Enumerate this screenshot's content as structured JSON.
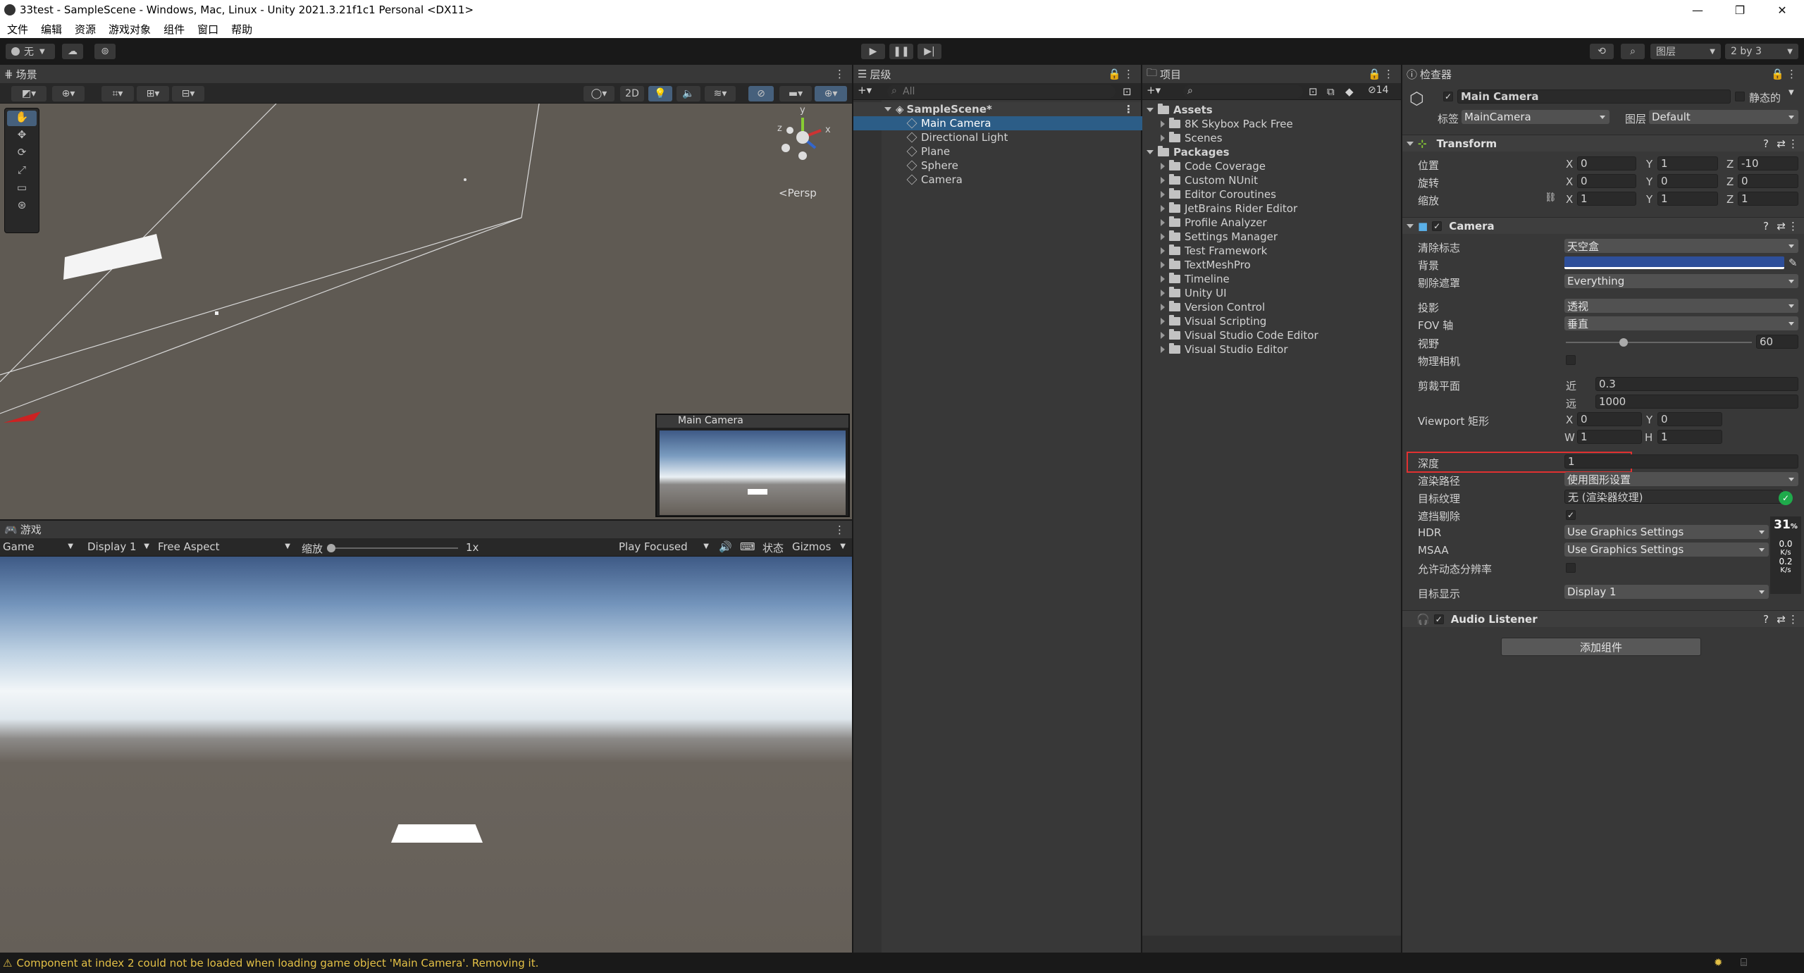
{
  "window": {
    "title": "33test - SampleScene - Windows, Mac, Linux - Unity 2021.3.21f1c1 Personal <DX11>",
    "minimize": "—",
    "maximize": "❐",
    "close": "✕"
  },
  "menu": [
    "文件",
    "编辑",
    "资源",
    "游戏对象",
    "组件",
    "窗口",
    "帮助"
  ],
  "toolbar": {
    "account": "无",
    "layers_label": "图层",
    "layout_label": "2 by 3"
  },
  "scene": {
    "tab": "场景",
    "toggle_2d": "2D",
    "persp_label": "<Persp",
    "gizmo_y": "y",
    "gizmo_x": "x",
    "gizmo_z": "z",
    "camera_preview_title": "Main Camera"
  },
  "game": {
    "tab": "游戏",
    "mode": "Game",
    "display": "Display 1",
    "aspect": "Free Aspect",
    "scale_label": "缩放",
    "scale_value": "1x",
    "scale_level": 0,
    "play_mode": "Play Focused",
    "stats_label": "状态",
    "gizmos_label": "Gizmos"
  },
  "hierarchy": {
    "tab": "层级",
    "search_placeholder": "All",
    "scene_name": "SampleScene*",
    "items": [
      "Main Camera",
      "Directional Light",
      "Plane",
      "Sphere",
      "Camera"
    ]
  },
  "project": {
    "tab": "项目",
    "hidden_count": "14",
    "assets_label": "Assets",
    "assets": [
      "8K Skybox Pack Free",
      "Scenes"
    ],
    "packages_label": "Packages",
    "packages": [
      "Code Coverage",
      "Custom NUnit",
      "Editor Coroutines",
      "JetBrains Rider Editor",
      "Profile Analyzer",
      "Settings Manager",
      "Test Framework",
      "TextMeshPro",
      "Timeline",
      "Unity UI",
      "Version Control",
      "Visual Scripting",
      "Visual Studio Code Editor",
      "Visual Studio Editor"
    ]
  },
  "inspector": {
    "tab": "检查器",
    "object_name": "Main Camera",
    "static_label": "静态的",
    "tag_label": "标签",
    "tag_value": "MainCamera",
    "layer_label": "图层",
    "layer_value": "Default",
    "transform": {
      "title": "Transform",
      "position_label": "位置",
      "rotation_label": "旋转",
      "scale_label": "缩放",
      "position": {
        "x": "0",
        "y": "1",
        "z": "-10"
      },
      "rotation": {
        "x": "0",
        "y": "0",
        "z": "0"
      },
      "scale": {
        "x": "1",
        "y": "1",
        "z": "1"
      }
    },
    "camera": {
      "title": "Camera",
      "clear_flags_label": "清除标志",
      "clear_flags_value": "天空盒",
      "background_label": "背景",
      "background_color": "#2e4f9a",
      "culling_label": "剔除遮罩",
      "culling_value": "Everything",
      "projection_label": "投影",
      "projection_value": "透视",
      "fov_axis_label": "FOV 轴",
      "fov_axis_value": "垂直",
      "fov_label": "视野",
      "fov_value": "60",
      "fov_slider_level": 0.31,
      "physical_label": "物理相机",
      "clipping_label": "剪裁平面",
      "near_label": "近",
      "near_value": "0.3",
      "far_label": "远",
      "far_value": "1000",
      "viewport_label": "Viewport 矩形",
      "viewport": {
        "x": "0",
        "y": "0",
        "w": "1",
        "h": "1"
      },
      "depth_label": "深度",
      "depth_value": "1",
      "render_path_label": "渲染路径",
      "render_path_value": "使用图形设置",
      "target_texture_label": "目标纹理",
      "target_texture_value": "无 (渲染器纹理)",
      "occlusion_label": "遮挡剔除",
      "hdr_label": "HDR",
      "hdr_value": "Use Graphics Settings",
      "msaa_label": "MSAA",
      "msaa_value": "Use Graphics Settings",
      "dynamic_res_label": "允许动态分辨率",
      "target_display_label": "目标显示",
      "target_display_value": "Display 1"
    },
    "audio_listener_title": "Audio Listener",
    "add_component": "添加组件",
    "overlay": {
      "fps": "31",
      "fps_unit": "%",
      "up": "0.0",
      "up_unit": "K/s",
      "down": "0.2",
      "down_unit": "K/s"
    }
  },
  "status": {
    "message": "Component at index 2 could not be loaded when loading game object 'Main Camera'. Removing it."
  },
  "colors": {
    "accent_selection": "#2c5d87",
    "highlight_red": "#e03131",
    "warning": "#e3c046"
  }
}
